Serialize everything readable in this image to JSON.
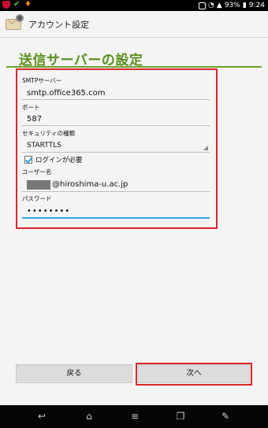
{
  "status_bar": {
    "battery": "93%",
    "time": "9:24",
    "icons": [
      "shield-icon",
      "check-icon",
      "notification-icon",
      "nfc-icon",
      "wifi-icon",
      "signal-icon",
      "battery-icon"
    ]
  },
  "action_bar": {
    "title": "アカウント設定",
    "icon": "email-settings-icon"
  },
  "page": {
    "title": "送信サーバーの設定"
  },
  "form": {
    "smtp_label": "SMTPサーバー",
    "smtp_value": "smtp.office365.com",
    "port_label": "ポート",
    "port_value": "587",
    "security_label": "セキュリティの種類",
    "security_value": "STARTTLS",
    "login_required_label": "ログインが必要",
    "login_required": true,
    "username_label": "ユーザー名",
    "username_value": "@hiroshima-u.ac.jp",
    "password_label": "パスワード",
    "password_value": "••••••••"
  },
  "buttons": {
    "back": "戻る",
    "next": "次へ"
  },
  "nav": {
    "icons": [
      "back-icon",
      "home-icon",
      "menu-icon",
      "recent-apps-icon",
      "edit-icon"
    ]
  },
  "colors": {
    "heading": "#5a8f1e",
    "highlight": "#d8262c",
    "focus": "#33a6dc"
  }
}
